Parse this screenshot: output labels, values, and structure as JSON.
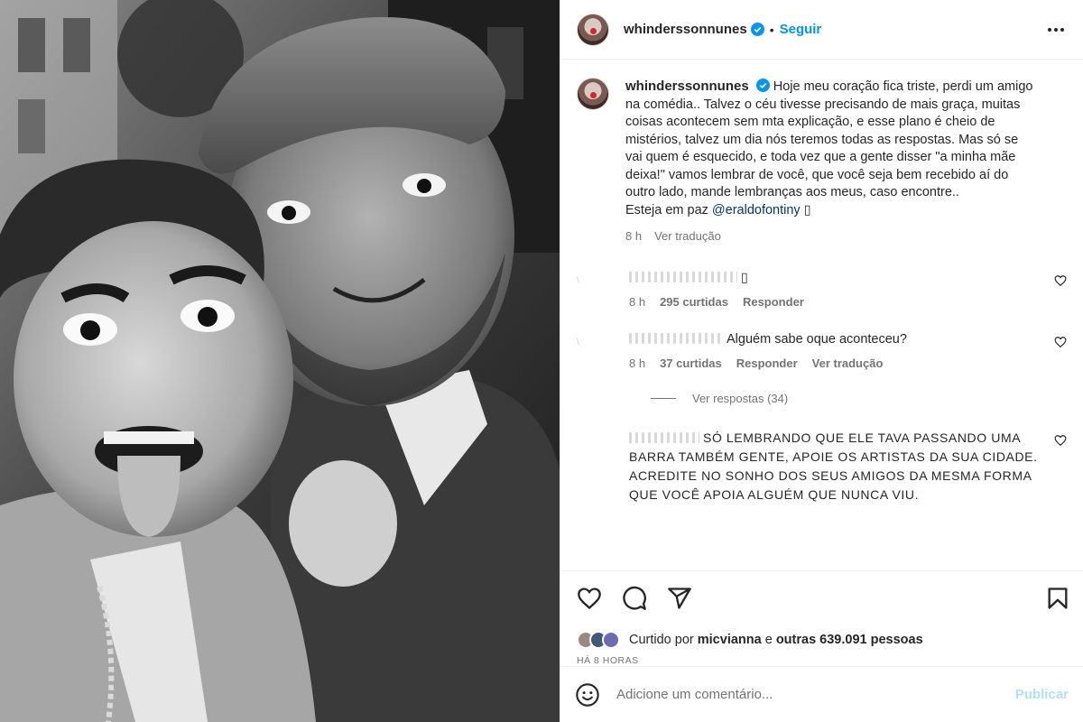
{
  "post": {
    "username": "whinderssonnunes",
    "follow_label": "Seguir",
    "separator": "•"
  },
  "caption": {
    "username": "whinderssonnunes",
    "text": "Hoje meu coração fica triste, perdi um amigo na comédia.. Talvez o céu tivesse precisando de mais graça, muitas coisas acontecem sem mta explicação, e esse plano é cheio de mistérios, talvez um dia nós teremos todas as respostas. Mas só se vai quem é esquecido, e toda vez que a gente disser \"a minha mãe deixa!\" vamos lembrar de você, que você seja bem recebido aí do outro lado, mande lembranças aos meus, caso encontre..",
    "peace_prefix": "Esteja em paz",
    "mention": "@eraldofontiny",
    "trailing_glyph": "▯",
    "time": "8 h",
    "see_translation": "Ver tradução"
  },
  "comments": [
    {
      "text": "▯",
      "time": "8 h",
      "likes": "295 curtidas",
      "reply": "Responder",
      "translation": ""
    },
    {
      "text": "Alguém sabe oque aconteceu?",
      "time": "8 h",
      "likes": "37 curtidas",
      "reply": "Responder",
      "translation": "Ver tradução",
      "view_replies": "Ver respostas (34)"
    },
    {
      "text": "SÓ LEMBRANDO QUE ELE TAVA PASSANDO UMA BARRA TAMBÉM GENTE, APOIE OS ARTISTAS DA SUA CIDADE. ACREDITE NO SONHO DOS SEUS AMIGOS DA MESMA FORMA QUE VOCÊ APOIA ALGUÉM QUE NUNCA VIU."
    }
  ],
  "likes": {
    "prefix": "Curtido por",
    "user": "micvianna",
    "conjunction": "e",
    "others": "outras 639.091 pessoas"
  },
  "posted_ago": "HÁ 8 HORAS",
  "add_comment": {
    "placeholder": "Adicione um comentário...",
    "publish_label": "Publicar"
  },
  "colors": {
    "link": "#0095f6",
    "publish_disabled": "#b2dffc",
    "secondary_text": "#737373"
  },
  "icons": [
    "more-options-icon",
    "verified-badge-icon",
    "heart-icon",
    "comment-icon",
    "share-icon",
    "bookmark-icon",
    "emoji-icon"
  ]
}
